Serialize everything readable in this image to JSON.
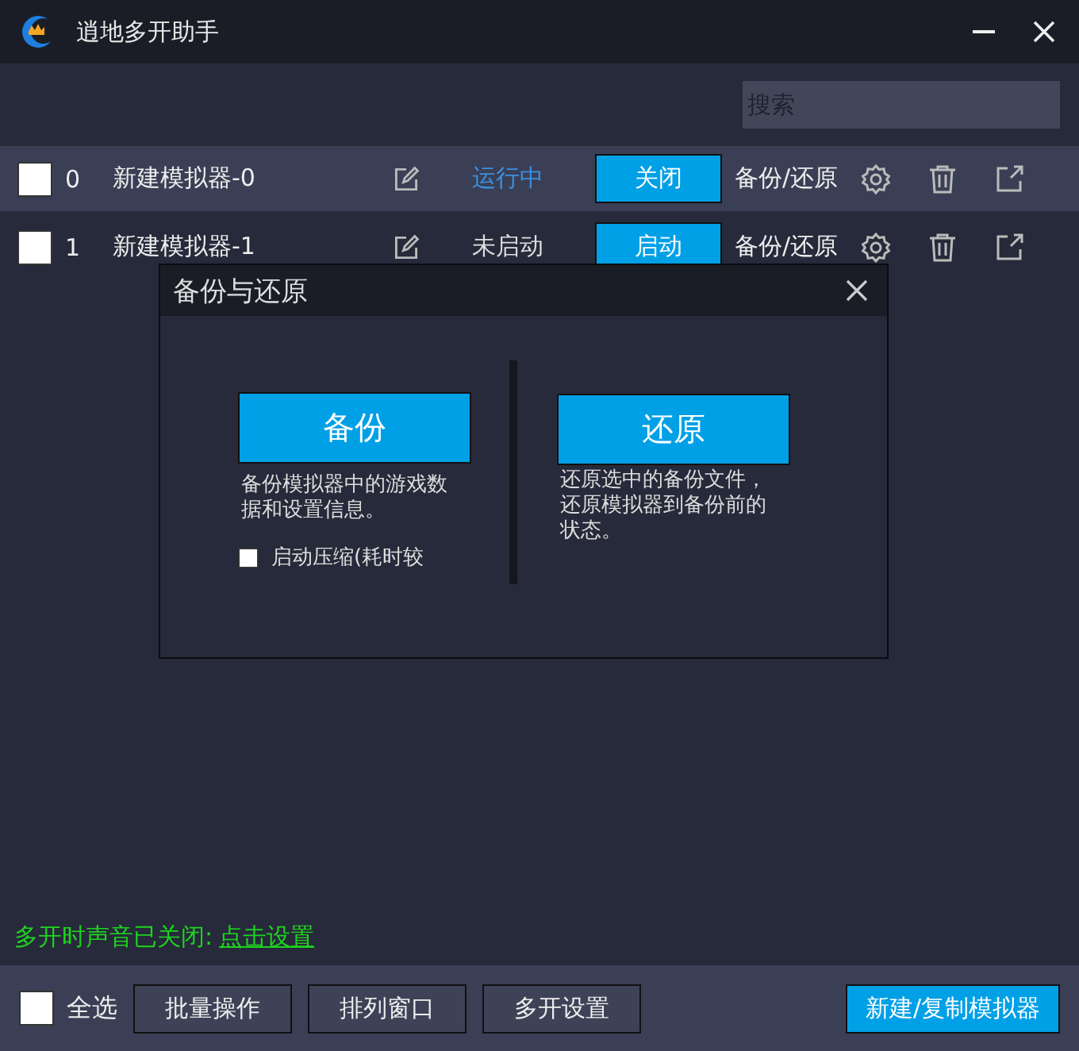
{
  "window": {
    "title": "逍地多开助手"
  },
  "search": {
    "placeholder": "搜索"
  },
  "rows": [
    {
      "checked": false,
      "highlighted": true,
      "index": "0",
      "name": "新建模拟器-0",
      "status": "运行中",
      "running": true,
      "action": "关闭",
      "backup": "备份/还原"
    },
    {
      "checked": false,
      "highlighted": false,
      "index": "1",
      "name": "新建模拟器-1",
      "status": "未启动",
      "running": false,
      "action": "启动",
      "backup": "备份/还原"
    }
  ],
  "dialog": {
    "title": "备份与还原",
    "backup": {
      "button": "备份",
      "description": "备份模拟器中的游戏数据和设置信息。",
      "option": {
        "label": "启动压缩(耗时较",
        "checked": false
      }
    },
    "restore": {
      "button": "还原",
      "description": "还原选中的备份文件，还原模拟器到备份前的状态。"
    }
  },
  "notice": {
    "text": "多开时声音已关闭:",
    "link": "点击设置"
  },
  "footer": {
    "select_all": {
      "label": "全选",
      "checked": false
    },
    "buttons": [
      "批量操作",
      "排列窗口",
      "多开设置"
    ],
    "primary": "新建/复制模拟器"
  }
}
